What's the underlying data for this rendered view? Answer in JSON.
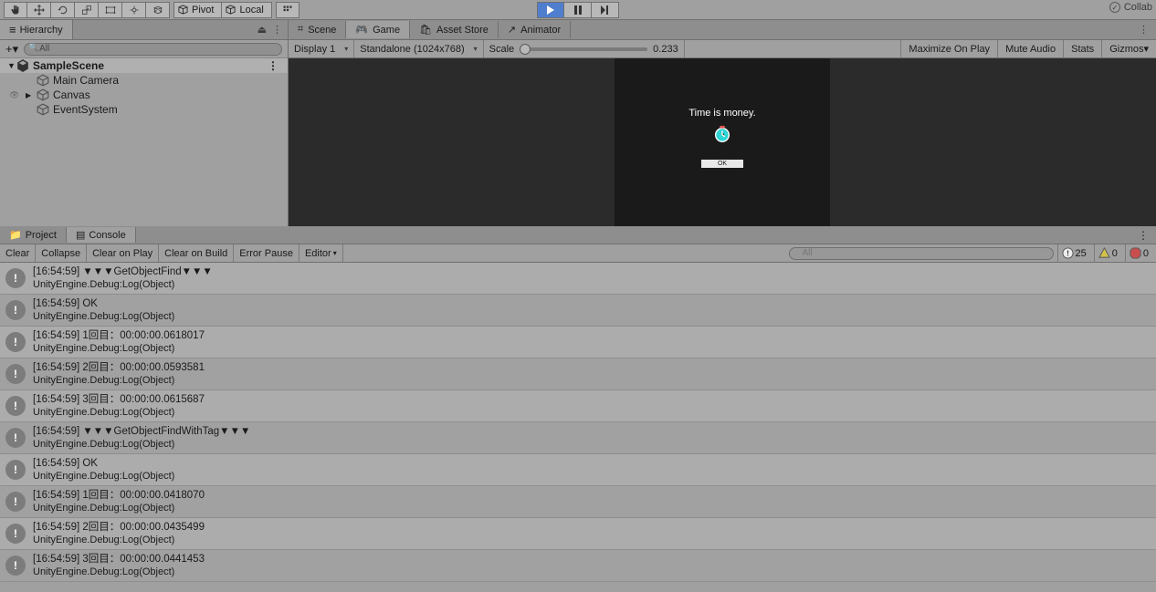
{
  "toolbar": {
    "pivot_label": "Pivot",
    "local_label": "Local",
    "collab_label": "Collab"
  },
  "hierarchy": {
    "title": "Hierarchy",
    "search_placeholder": "All",
    "scene": "SampleScene",
    "items": [
      "Main Camera",
      "Canvas",
      "EventSystem"
    ]
  },
  "scene_panel": {
    "tabs": [
      "Scene",
      "Game",
      "Asset Store",
      "Animator"
    ],
    "display": "Display 1",
    "resolution": "Standalone (1024x768)",
    "scale_label": "Scale",
    "scale_value": "0.233",
    "right_opts": [
      "Maximize On Play",
      "Mute Audio",
      "Stats",
      "Gizmos"
    ]
  },
  "game": {
    "message": "Time is money.",
    "button": "OK"
  },
  "lower_tabs": {
    "project": "Project",
    "console": "Console"
  },
  "console": {
    "buttons": [
      "Clear",
      "Collapse",
      "Clear on Play",
      "Clear on Build",
      "Error Pause"
    ],
    "editor": "Editor",
    "info_count": "25",
    "warn_count": "0",
    "err_count": "0",
    "logs": [
      {
        "l1": "[16:54:59] ▼▼▼GetObjectFind▼▼▼",
        "l2": "UnityEngine.Debug:Log(Object)"
      },
      {
        "l1": "[16:54:59] OK",
        "l2": "UnityEngine.Debug:Log(Object)"
      },
      {
        "l1": "[16:54:59] 1回目：00:00:00.0618017",
        "l2": "UnityEngine.Debug:Log(Object)"
      },
      {
        "l1": "[16:54:59] 2回目：00:00:00.0593581",
        "l2": "UnityEngine.Debug:Log(Object)"
      },
      {
        "l1": "[16:54:59] 3回目：00:00:00.0615687",
        "l2": "UnityEngine.Debug:Log(Object)"
      },
      {
        "l1": "[16:54:59] ▼▼▼GetObjectFindWithTag▼▼▼",
        "l2": "UnityEngine.Debug:Log(Object)"
      },
      {
        "l1": "[16:54:59] OK",
        "l2": "UnityEngine.Debug:Log(Object)"
      },
      {
        "l1": "[16:54:59] 1回目：00:00:00.0418070",
        "l2": "UnityEngine.Debug:Log(Object)"
      },
      {
        "l1": "[16:54:59] 2回目：00:00:00.0435499",
        "l2": "UnityEngine.Debug:Log(Object)"
      },
      {
        "l1": "[16:54:59] 3回目：00:00:00.0441453",
        "l2": "UnityEngine.Debug:Log(Object)"
      }
    ]
  }
}
